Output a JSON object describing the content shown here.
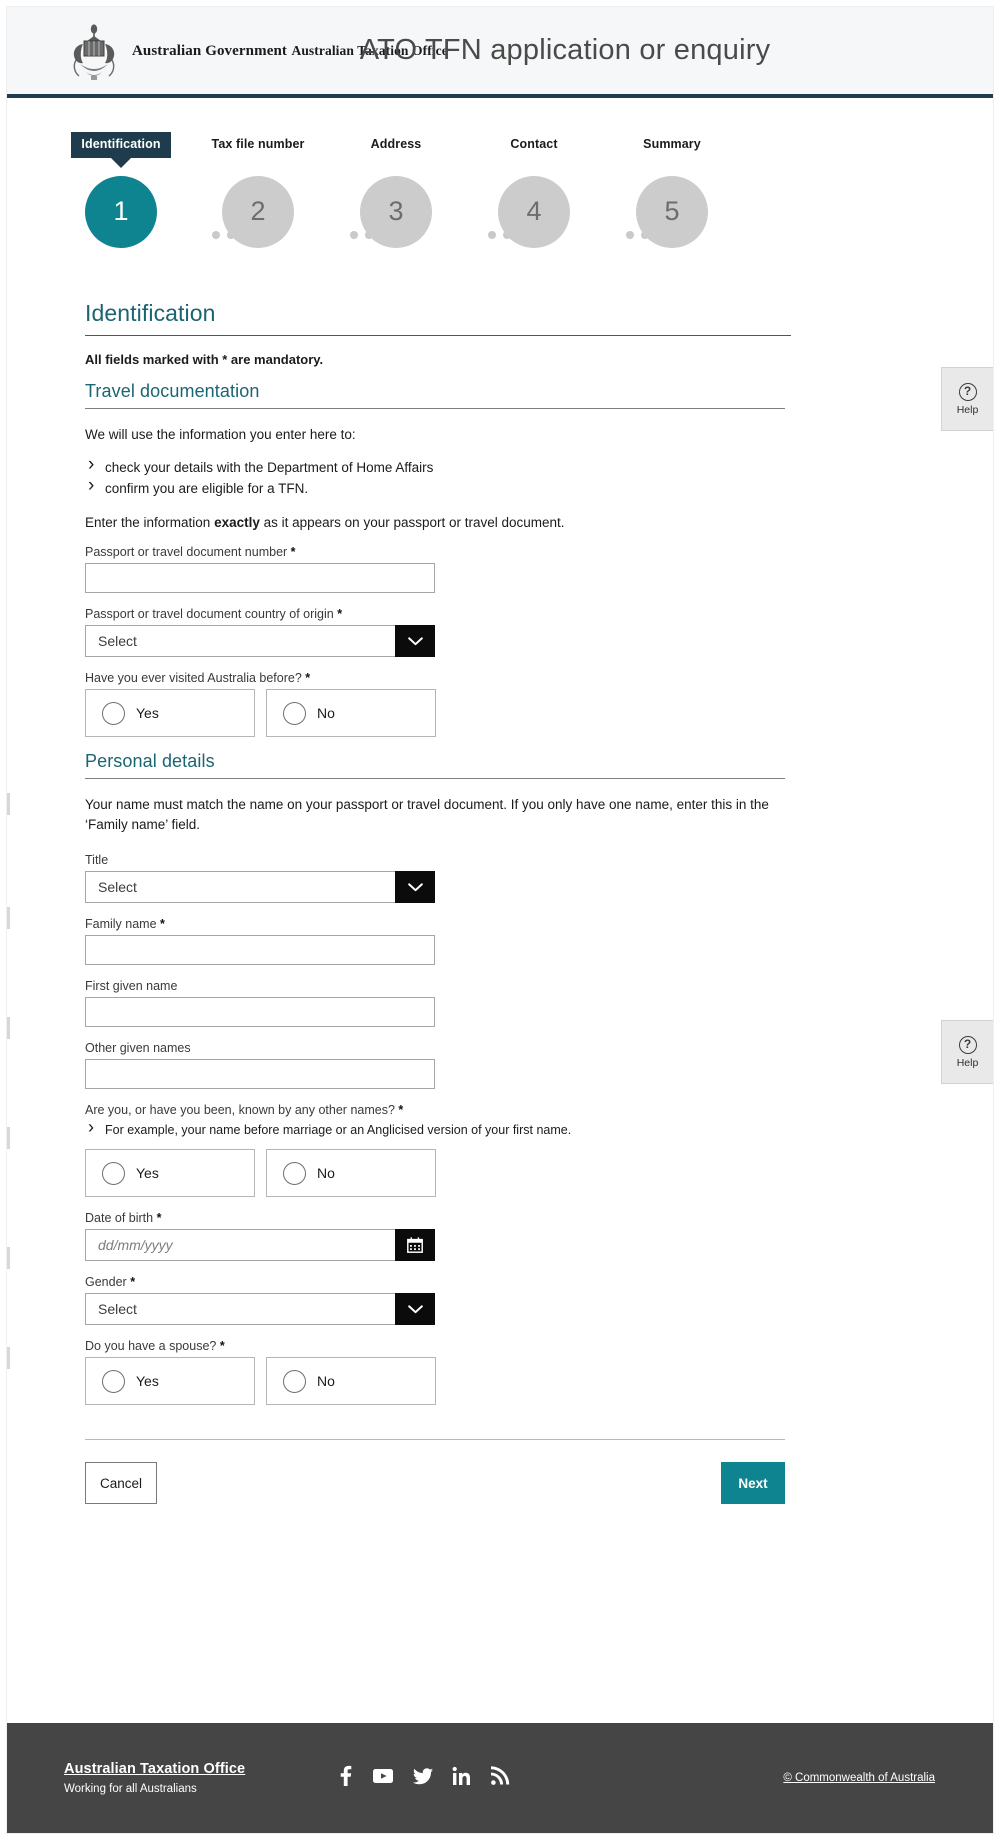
{
  "header": {
    "crest_alt": "australian-coat-of-arms",
    "brand_line1": "Australian Government",
    "brand_line2": "Australian Taxation Office",
    "app_title": "ATO TFN application or enquiry"
  },
  "stepper": {
    "steps": [
      {
        "label": "Identification",
        "number": "1",
        "state": "current"
      },
      {
        "label": "Tax file number",
        "number": "2",
        "state": "upcoming"
      },
      {
        "label": "Address",
        "number": "3",
        "state": "upcoming"
      },
      {
        "label": "Contact",
        "number": "4",
        "state": "upcoming"
      },
      {
        "label": "Summary",
        "number": "5",
        "state": "upcoming"
      }
    ]
  },
  "page": {
    "title": "Identification",
    "mandatory_note": "All fields marked with * are mandatory."
  },
  "travel": {
    "heading": "Travel documentation",
    "intro": "We will use the information you enter here to:",
    "bullets": [
      "check your details with the Department of Home Affairs",
      "confirm you are eligible for a TFN."
    ],
    "exact_pre": "Enter the information ",
    "exact_bold": "exactly",
    "exact_post": " as it appears on your passport or travel document.",
    "passport_number_label": "Passport or travel document number",
    "passport_number_value": "",
    "country_label": "Passport or travel document country of origin",
    "country_value": "Select",
    "visited_label": "Have you ever visited Australia before?",
    "visited_yes": "Yes",
    "visited_no": "No"
  },
  "personal": {
    "heading": "Personal details",
    "intro": "Your name must match the name on your passport or travel document. If you only have one name, enter this in the ‘Family name’ field.",
    "title_label": "Title",
    "title_value": "Select",
    "family_label": "Family name",
    "family_value": "",
    "first_label": "First given name",
    "first_value": "",
    "other_label": "Other given names",
    "other_value": "",
    "known_label": "Are you, or have you been, known by any other names?",
    "known_hint": "For example, your name before marriage or an Anglicised version of your first name.",
    "known_yes": "Yes",
    "known_no": "No",
    "dob_label": "Date of birth",
    "dob_placeholder": "dd/mm/yyyy",
    "dob_value": "",
    "gender_label": "Gender",
    "gender_value": "Select",
    "spouse_label": "Do you have a spouse?",
    "spouse_yes": "Yes",
    "spouse_no": "No"
  },
  "actions": {
    "cancel_label": "Cancel",
    "next_label": "Next"
  },
  "help": {
    "label_top": "Help",
    "label_bottom": "Help",
    "glyph": "?"
  },
  "footer": {
    "org": "Australian Taxation Office",
    "tagline": "Working for all Australians",
    "copyright": "© Commonwealth of Australia",
    "social": [
      "facebook-icon",
      "youtube-icon",
      "twitter-icon",
      "linkedin-icon",
      "rss-icon"
    ]
  },
  "colors": {
    "teal": "#0e8490",
    "heading_teal": "#1b6471",
    "navy": "#1e3c4b",
    "footer_grey": "#454545",
    "step_grey": "#cccccc"
  },
  "required_marker": "*"
}
